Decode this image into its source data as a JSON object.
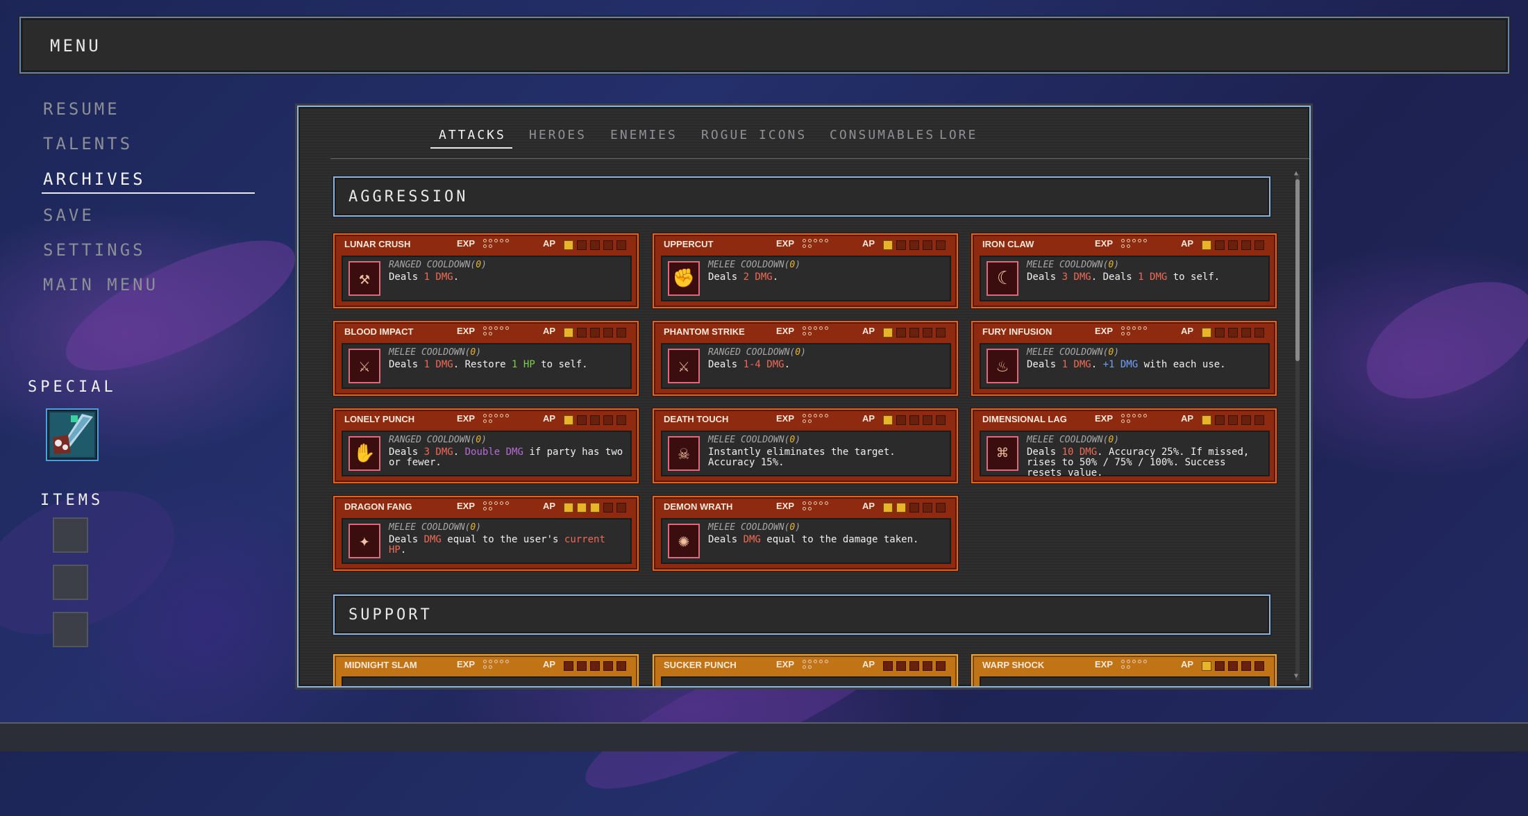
{
  "menu_title": "MENU",
  "nav": [
    "RESUME",
    "TALENTS",
    "ARCHIVES",
    "SAVE",
    "SETTINGS",
    "MAIN MENU"
  ],
  "special_label": "SPECIAL",
  "items_label": "ITEMS",
  "tabs": [
    "ATTACKS",
    "HEROES",
    "ENEMIES",
    "ROGUE ICONS",
    "CONSUMABLES",
    "LORE"
  ],
  "sections": [
    "AGGRESSION",
    "SUPPORT"
  ],
  "labels": {
    "exp": "EXP",
    "ap": "AP"
  },
  "cards": [
    {
      "name": "LUNAR CRUSH",
      "type": "RANGED",
      "cooldown": "COOLDOWN",
      "cd": "0",
      "ap": 1,
      "icon": "hammer-icon",
      "desc": [
        {
          "t": "Deals "
        },
        {
          "t": "1 DMG",
          "c": "r"
        },
        {
          "t": "."
        }
      ]
    },
    {
      "name": "UPPERCUT",
      "type": "MELEE",
      "cooldown": "COOLDOWN",
      "cd": "0",
      "ap": 1,
      "icon": "fist-icon",
      "desc": [
        {
          "t": "Deals "
        },
        {
          "t": "2 DMG",
          "c": "r"
        },
        {
          "t": "."
        }
      ]
    },
    {
      "name": "IRON CLAW",
      "type": "MELEE",
      "cooldown": "COOLDOWN",
      "cd": "0",
      "ap": 1,
      "icon": "claw-icon",
      "desc": [
        {
          "t": "Deals "
        },
        {
          "t": "3 DMG",
          "c": "r"
        },
        {
          "t": ". Deals "
        },
        {
          "t": "1 DMG",
          "c": "r"
        },
        {
          "t": " to self."
        }
      ]
    },
    {
      "name": "BLOOD IMPACT",
      "type": "MELEE",
      "cooldown": "COOLDOWN",
      "cd": "0",
      "ap": 1,
      "icon": "blood-blade-icon",
      "desc": [
        {
          "t": "Deals "
        },
        {
          "t": "1 DMG",
          "c": "r"
        },
        {
          "t": ". Restore "
        },
        {
          "t": "1 HP",
          "c": "g"
        },
        {
          "t": " to self."
        }
      ]
    },
    {
      "name": "PHANTOM STRIKE",
      "type": "RANGED",
      "cooldown": "COOLDOWN",
      "cd": "0",
      "ap": 1,
      "icon": "crossed-swords-icon",
      "desc": [
        {
          "t": "Deals "
        },
        {
          "t": "1-4 DMG",
          "c": "r"
        },
        {
          "t": "."
        }
      ]
    },
    {
      "name": "FURY INFUSION",
      "type": "MELEE",
      "cooldown": "COOLDOWN",
      "cd": "0",
      "ap": 1,
      "icon": "fury-icon",
      "desc": [
        {
          "t": "Deals "
        },
        {
          "t": "1 DMG",
          "c": "r"
        },
        {
          "t": ". "
        },
        {
          "t": "+1 DMG",
          "c": "b"
        },
        {
          "t": " with each use."
        }
      ]
    },
    {
      "name": "LONELY PUNCH",
      "type": "RANGED",
      "cooldown": "COOLDOWN",
      "cd": "0",
      "ap": 1,
      "icon": "lonely-punch-icon",
      "desc": [
        {
          "t": "Deals "
        },
        {
          "t": "3 DMG",
          "c": "r"
        },
        {
          "t": ". "
        },
        {
          "t": "Double DMG",
          "c": "p"
        },
        {
          "t": " if party has two or fewer."
        }
      ]
    },
    {
      "name": "DEATH TOUCH",
      "type": "MELEE",
      "cooldown": "COOLDOWN",
      "cd": "0",
      "ap": 1,
      "icon": "death-hand-icon",
      "desc": [
        {
          "t": "Instantly eliminates the target. Accuracy 15%."
        }
      ]
    },
    {
      "name": "DIMENSIONAL LAG",
      "type": "MELEE",
      "cooldown": "COOLDOWN",
      "cd": "0",
      "ap": 1,
      "icon": "portal-icon",
      "desc": [
        {
          "t": "Deals "
        },
        {
          "t": "10 DMG",
          "c": "r"
        },
        {
          "t": ". Accuracy 25%. If missed, rises to 50% / 75% / 100%. Success resets value."
        }
      ]
    },
    {
      "name": "DRAGON FANG",
      "type": "MELEE",
      "cooldown": "COOLDOWN",
      "cd": "0",
      "ap": 3,
      "icon": "dragon-fang-icon",
      "desc": [
        {
          "t": "Deals "
        },
        {
          "t": "DMG",
          "c": "r"
        },
        {
          "t": " equal to the user's "
        },
        {
          "t": "current HP",
          "c": "r"
        },
        {
          "t": "."
        }
      ]
    },
    {
      "name": "DEMON WRATH",
      "type": "MELEE",
      "cooldown": "COOLDOWN",
      "cd": "0",
      "ap": 2,
      "icon": "demon-burst-icon",
      "desc": [
        {
          "t": "Deals "
        },
        {
          "t": "DMG",
          "c": "r"
        },
        {
          "t": " equal to the damage taken."
        }
      ]
    }
  ],
  "support_cards": [
    {
      "name": "MIDNIGHT SLAM",
      "ap": 0
    },
    {
      "name": "SUCKER PUNCH",
      "ap": 0
    },
    {
      "name": "WARP SHOCK",
      "ap": 1
    }
  ],
  "colors": {
    "accent_frame": "#93b6d6",
    "aggression_card": "#8e2a0f",
    "support_card": "#c07415",
    "ap_filled": "#e8b42a"
  }
}
